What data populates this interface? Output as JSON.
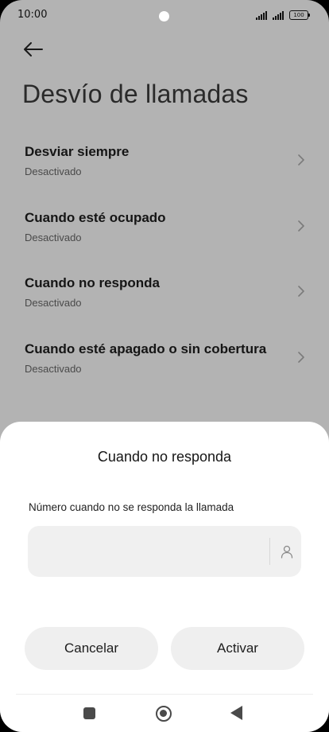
{
  "status_bar": {
    "time": "10:00",
    "battery": "100"
  },
  "header": {
    "back_icon": "arrow-left-icon",
    "title": "Desvío de llamadas"
  },
  "settings": {
    "items": [
      {
        "title": "Desviar siempre",
        "subtitle": "Desactivado"
      },
      {
        "title": "Cuando esté ocupado",
        "subtitle": "Desactivado"
      },
      {
        "title": "Cuando no responda",
        "subtitle": "Desactivado"
      },
      {
        "title": "Cuando esté apagado o sin cobertura",
        "subtitle": "Desactivado"
      }
    ]
  },
  "dialog": {
    "title": "Cuando no responda",
    "field_label": "Número cuando no se responda la llamada",
    "field_value": "",
    "contact_icon": "contact-person-icon",
    "cancel_label": "Cancelar",
    "activate_label": "Activar"
  },
  "colors": {
    "overlay_background": "#b3b3b3",
    "sheet_background": "#ffffff",
    "button_background": "#efefef",
    "input_background": "#f0f0f0"
  }
}
